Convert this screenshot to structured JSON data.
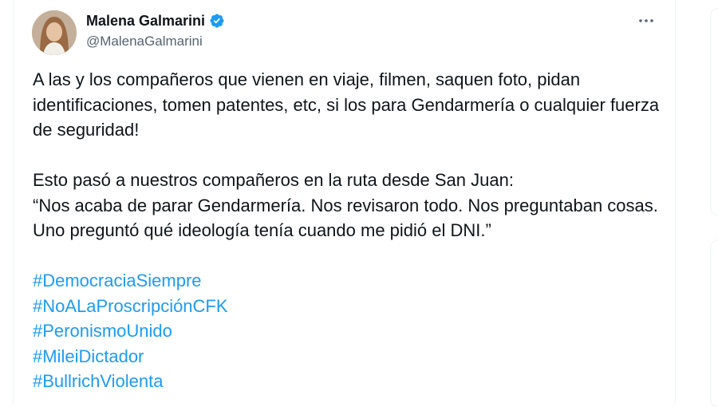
{
  "author": {
    "display_name": "Malena Galmarini",
    "handle": "@MalenaGalmarini",
    "verified": true
  },
  "icons": {
    "verified": "verified-badge-icon",
    "more": "more-options-icon"
  },
  "colors": {
    "hashtag": "#1d9bf0",
    "verified": "#1d9bf0",
    "secondary_text": "#536471",
    "text": "#0f1419"
  },
  "tweet": {
    "paragraph_1": "A las y los compañeros que vienen en viaje, filmen, saquen foto, pidan identificaciones, tomen patentes, etc, si los para Gendarmería o cualquier fuerza de seguridad!",
    "paragraph_2_line_1": "Esto pasó a nuestros compañeros en la ruta desde San Juan:",
    "paragraph_2_line_2": "“Nos acaba de parar Gendarmería. Nos revisaron todo. Nos preguntaban cosas. Uno preguntó qué ideología tenía cuando me pidió el DNI.”",
    "hashtags": [
      "#DemocraciaSiempre",
      "#NoALaProscripciónCFK",
      "#PeronismoUnido",
      "#MileiDictador",
      "#BullrichViolenta"
    ]
  }
}
